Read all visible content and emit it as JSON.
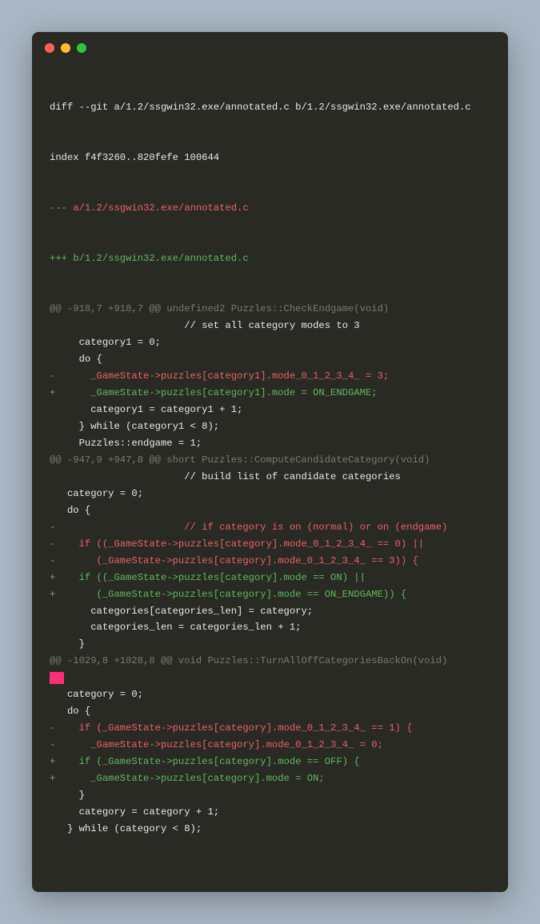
{
  "diff": {
    "header1": "diff --git a/1.2/ssgwin32.exe/annotated.c b/1.2/ssgwin32.exe/annotated.c",
    "header2": "index f4f3260..820fefe 100644",
    "file_a": "--- a/1.2/ssgwin32.exe/annotated.c",
    "file_b": "+++ b/1.2/ssgwin32.exe/annotated.c",
    "hunks": [
      {
        "header": "@@ -918,7 +918,7 @@ undefined2 Puzzles::CheckEndgame(void)",
        "lines": [
          {
            "type": "context",
            "text": "                       // set all category modes to 3"
          },
          {
            "type": "context",
            "text": "     category1 = 0;"
          },
          {
            "type": "context",
            "text": "     do {"
          },
          {
            "type": "remove",
            "text": "-      _GameState->puzzles[category1].mode_0_1_2_3_4_ = 3;"
          },
          {
            "type": "add",
            "text": "+      _GameState->puzzles[category1].mode = ON_ENDGAME;"
          },
          {
            "type": "context",
            "text": "       category1 = category1 + 1;"
          },
          {
            "type": "context",
            "text": "     } while (category1 < 8);"
          },
          {
            "type": "context",
            "text": "     Puzzles::endgame = 1;"
          }
        ]
      },
      {
        "header": "@@ -947,9 +947,8 @@ short Puzzles::ComputeCandidateCategory(void)",
        "lines": [
          {
            "type": "context",
            "text": "                       // build list of candidate categories"
          },
          {
            "type": "context",
            "text": "   category = 0;"
          },
          {
            "type": "context",
            "text": "   do {"
          },
          {
            "type": "remove",
            "text": "-                      // if category is on (normal) or on (endgame)"
          },
          {
            "type": "remove",
            "text": "-    if ((_GameState->puzzles[category].mode_0_1_2_3_4_ == 0) ||"
          },
          {
            "type": "remove",
            "text": "-       (_GameState->puzzles[category].mode_0_1_2_3_4_ == 3)) {"
          },
          {
            "type": "add",
            "text": "+    if ((_GameState->puzzles[category].mode == ON) ||"
          },
          {
            "type": "add",
            "text": "+       (_GameState->puzzles[category].mode == ON_ENDGAME)) {"
          },
          {
            "type": "context",
            "text": "       categories[categories_len] = category;"
          },
          {
            "type": "context",
            "text": "       categories_len = categories_len + 1;"
          },
          {
            "type": "context",
            "text": "     }"
          }
        ]
      },
      {
        "header": "@@ -1029,8 +1028,8 @@ void Puzzles::TurnAllOffCategoriesBackOn(void)",
        "lines": [
          {
            "type": "highlight",
            "text": " "
          },
          {
            "type": "context",
            "text": "   category = 0;"
          },
          {
            "type": "context",
            "text": "   do {"
          },
          {
            "type": "remove",
            "text": "-    if (_GameState->puzzles[category].mode_0_1_2_3_4_ == 1) {"
          },
          {
            "type": "remove",
            "text": "-      _GameState->puzzles[category].mode_0_1_2_3_4_ = 0;"
          },
          {
            "type": "add",
            "text": "+    if (_GameState->puzzles[category].mode == OFF) {"
          },
          {
            "type": "add",
            "text": "+      _GameState->puzzles[category].mode = ON;"
          },
          {
            "type": "context",
            "text": "     }"
          },
          {
            "type": "context",
            "text": "     category = category + 1;"
          },
          {
            "type": "context",
            "text": "   } while (category < 8);"
          }
        ]
      }
    ]
  }
}
